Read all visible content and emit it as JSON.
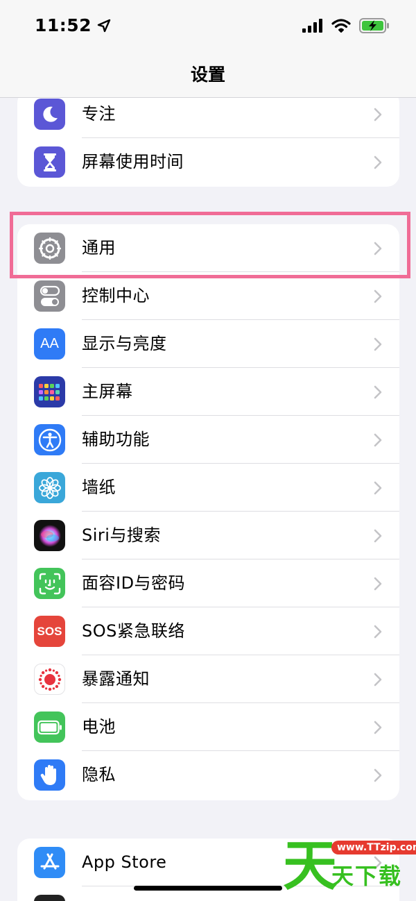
{
  "status_bar": {
    "time": "11:52",
    "location_icon": "location-arrow-icon",
    "signal_icon": "cellular-signal-icon",
    "wifi_icon": "wifi-icon",
    "battery_icon": "battery-charging-icon"
  },
  "nav": {
    "title": "设置"
  },
  "group1": [
    {
      "label": "专注",
      "icon": "moon-icon",
      "color": "#5b57d6"
    },
    {
      "label": "屏幕使用时间",
      "icon": "hourglass-icon",
      "color": "#5b57d6"
    }
  ],
  "group2": [
    {
      "label": "通用",
      "icon": "gear-icon",
      "color": "#8e8e93"
    },
    {
      "label": "控制中心",
      "icon": "toggles-icon",
      "color": "#8e8e93"
    },
    {
      "label": "显示与亮度",
      "icon": "text-size-icon",
      "icon_text": "AA",
      "color": "#2f7bf6"
    },
    {
      "label": "主屏幕",
      "icon": "home-screen-grid-icon",
      "color": "#2b3aa8"
    },
    {
      "label": "辅助功能",
      "icon": "accessibility-icon",
      "color": "#2f7bf6"
    },
    {
      "label": "墙纸",
      "icon": "flower-icon",
      "color": "#3aa7d9"
    },
    {
      "label": "Siri与搜索",
      "icon": "siri-orb-icon",
      "color": "#111111"
    },
    {
      "label": "面容ID与密码",
      "icon": "face-id-icon",
      "color": "#43c45a"
    },
    {
      "label": "SOS紧急联络",
      "icon": "sos-icon",
      "icon_text": "SOS",
      "color": "#e5453b"
    },
    {
      "label": "暴露通知",
      "icon": "exposure-notification-icon",
      "color": "#ffffff"
    },
    {
      "label": "电池",
      "icon": "battery-icon",
      "color": "#43c45a"
    },
    {
      "label": "隐私",
      "icon": "hand-icon",
      "color": "#2f7bf6"
    }
  ],
  "group3": [
    {
      "label": "App Store",
      "icon": "app-store-icon",
      "color": "#2f8cf6"
    }
  ],
  "watermark": {
    "url": "www.TTzip.com",
    "big": "天",
    "small": "天下载"
  }
}
